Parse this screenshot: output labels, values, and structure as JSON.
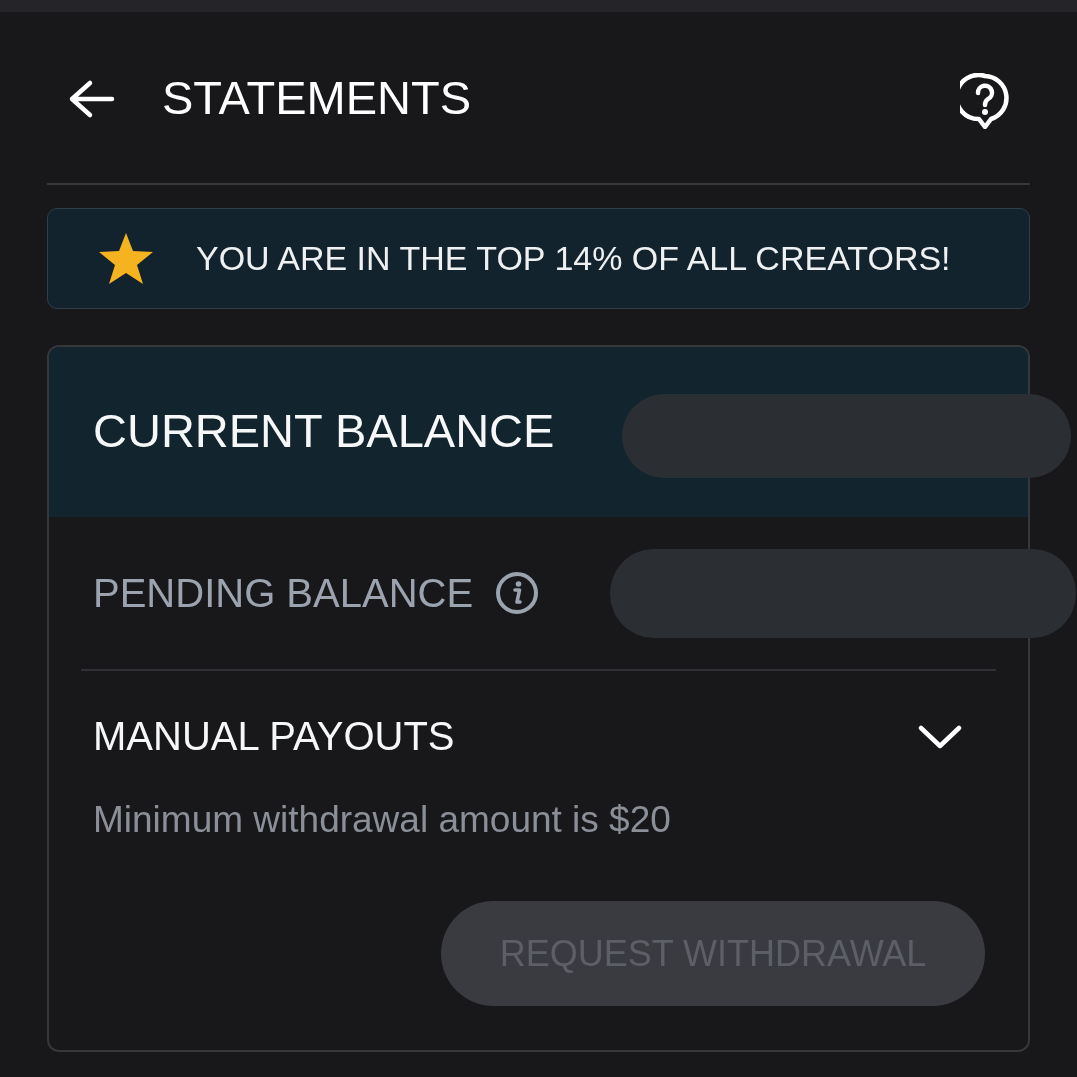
{
  "header": {
    "title": "STATEMENTS"
  },
  "banner": {
    "text": "YOU ARE IN THE TOP 14% OF ALL CREATORS!"
  },
  "balance_card": {
    "current_balance": {
      "label": "CURRENT BALANCE"
    },
    "pending_balance": {
      "label": "PENDING BALANCE"
    },
    "manual_payouts": {
      "title": "MANUAL PAYOUTS",
      "expanded": true,
      "note": "Minimum withdrawal amount is $20",
      "button": {
        "label": "REQUEST WITHDRAWAL",
        "disabled": true
      }
    }
  }
}
